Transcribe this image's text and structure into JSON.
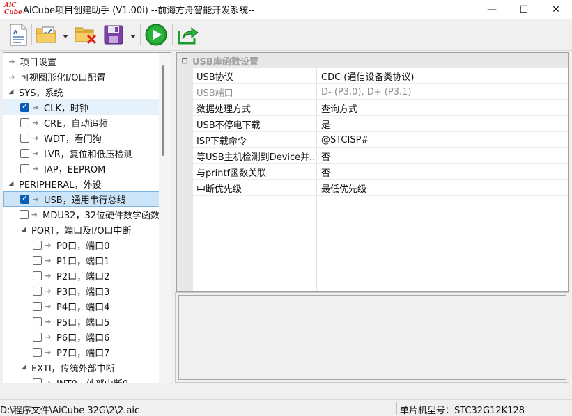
{
  "window": {
    "logo_top": "AiC",
    "logo_bottom": "Cube",
    "title": "AiCube项目创建助手 (V1.00i) --前海方舟智能开发系统--",
    "minimize": "—",
    "maximize": "☐",
    "close": "✕"
  },
  "toolbar": {
    "buttons": [
      "new-project",
      "open-project",
      "close-project",
      "save-project",
      "run",
      "export"
    ]
  },
  "tree": {
    "items": [
      {
        "label": "项目设置",
        "level": 0
      },
      {
        "label": "可视图形化I/O口配置",
        "level": 0
      },
      {
        "label": "SYS，系统",
        "level": 0,
        "expanded": true
      },
      {
        "label": "CLK，时钟",
        "level": 1,
        "checked": true
      },
      {
        "label": "CRE，自动追频",
        "level": 1,
        "checked": false
      },
      {
        "label": "WDT，看门狗",
        "level": 1,
        "checked": false
      },
      {
        "label": "LVR，复位和低压检测",
        "level": 1,
        "checked": false
      },
      {
        "label": "IAP，EEPROM",
        "level": 1,
        "checked": false
      },
      {
        "label": "PERIPHERAL，外设",
        "level": 0,
        "expanded": true
      },
      {
        "label": "USB，通用串行总线",
        "level": 1,
        "checked": true,
        "selected": true
      },
      {
        "label": "MDU32，32位硬件数学函数",
        "level": 1,
        "checked": false
      },
      {
        "label": "PORT，端口及I/O口中断",
        "level": 1,
        "expanded": true
      },
      {
        "label": "P0口，端口0",
        "level": 2,
        "checked": false
      },
      {
        "label": "P1口，端口1",
        "level": 2,
        "checked": false
      },
      {
        "label": "P2口，端口2",
        "level": 2,
        "checked": false
      },
      {
        "label": "P3口，端口3",
        "level": 2,
        "checked": false
      },
      {
        "label": "P4口，端口4",
        "level": 2,
        "checked": false
      },
      {
        "label": "P5口，端口5",
        "level": 2,
        "checked": false
      },
      {
        "label": "P6口，端口6",
        "level": 2,
        "checked": false
      },
      {
        "label": "P7口，端口7",
        "level": 2,
        "checked": false
      },
      {
        "label": "EXTI，传统外部中断",
        "level": 1,
        "expanded": true
      },
      {
        "label": "INT0，外部中断0",
        "level": 2,
        "checked": false
      }
    ]
  },
  "properties": {
    "category": "USB库函数设置",
    "rows": [
      {
        "name": "USB协议",
        "value": "CDC (通信设备类协议)"
      },
      {
        "name": "USB端口",
        "value": "D- (P3.0), D+ (P3.1)",
        "disabled": true
      },
      {
        "name": "数据处理方式",
        "value": "查询方式"
      },
      {
        "name": "USB不停电下载",
        "value": "是"
      },
      {
        "name": "ISP下载命令",
        "value": "@STCISP#"
      },
      {
        "name": "等USB主机检测到Device并...",
        "value": "否"
      },
      {
        "name": "与printf函数关联",
        "value": "否"
      },
      {
        "name": "中断优先级",
        "value": "最低优先级"
      }
    ]
  },
  "status": {
    "path": "D:\\程序文件\\AiCube  32G\\2\\2.aic",
    "mcu": "单片机型号：STC32G12K128"
  }
}
